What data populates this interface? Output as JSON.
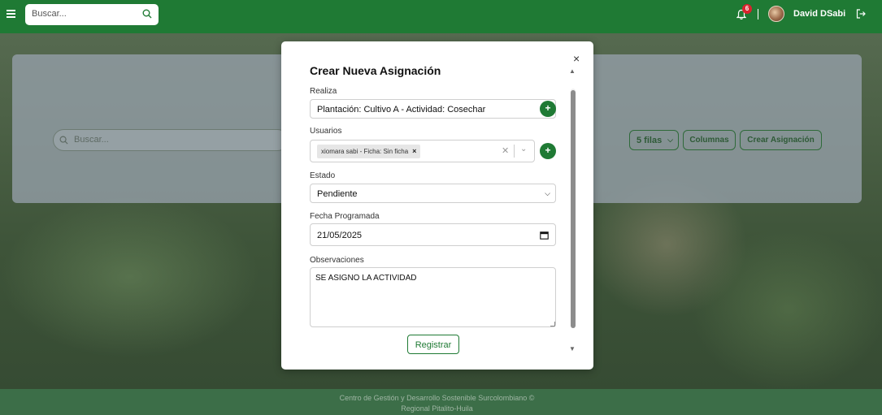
{
  "header": {
    "search_placeholder": "Buscar...",
    "notification_count": "6",
    "separator": "|",
    "username": "David DSabi"
  },
  "backdrop": {
    "search_placeholder": "Buscar...",
    "rows_label": "5 filas",
    "columns_label": "Columnas",
    "create_label": "Crear Asignación"
  },
  "modal": {
    "title": "Crear Nueva Asignación",
    "close_glyph": "×",
    "realiza": {
      "label": "Realiza",
      "value": "Plantación: Cultivo A - Actividad: Cosechar"
    },
    "usuarios": {
      "label": "Usuarios",
      "tag": "xiomara sabi - Ficha: Sin ficha"
    },
    "estado": {
      "label": "Estado",
      "value": "Pendiente"
    },
    "fecha": {
      "label": "Fecha Programada",
      "value": "21/05/2025"
    },
    "observaciones": {
      "label": "Observaciones",
      "value": "SE ASIGNO LA ACTIVIDAD"
    },
    "submit_label": "Registrar",
    "add_glyph": "+"
  },
  "footer": {
    "line1": "Centro de Gestión y Desarrollo Sostenible Surcolombiano ©",
    "line2": "Regional Pitalito-Huila"
  },
  "colors": {
    "brand_green": "#1f7a34",
    "badge_red": "#d9232e"
  },
  "icons": [
    "menu-icon",
    "search-icon",
    "bell-icon",
    "avatar",
    "logout-icon",
    "close-icon",
    "plus-icon",
    "chevron-down-icon",
    "calendar-icon"
  ]
}
